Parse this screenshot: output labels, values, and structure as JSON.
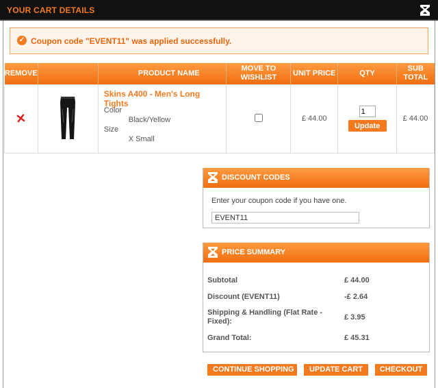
{
  "header": {
    "title": "YOUR CART DETAILS",
    "logo_icon": "brand-logo-icon"
  },
  "notice": {
    "message": "Coupon code \"EVENT11\" was applied successfully.",
    "icon": "check-circle-icon"
  },
  "cart": {
    "columns": [
      "REMOVE",
      "PRODUCT NAME",
      "MOVE TO WISHLIST",
      "UNIT PRICE",
      "QTY",
      "SUB TOTAL"
    ],
    "items": [
      {
        "remove_icon": "remove-x-icon",
        "image": "tights-product-image",
        "name": "Skins A400 - Men's Long Tights",
        "color_label": "Color",
        "color_value": "Black/Yellow",
        "size_label": "Size",
        "size_value": "X Small",
        "wishlist_checked": false,
        "unit_price": "£ 44.00",
        "qty": "1",
        "update_label": "Update",
        "subtotal": "£ 44.00"
      }
    ]
  },
  "discount": {
    "title": "DISCOUNT CODES",
    "prompt": "Enter your coupon code if you have one.",
    "code_value": "EVENT11"
  },
  "summary": {
    "title": "PRICE SUMMARY",
    "rows": [
      {
        "label": "Subtotal",
        "value": "£ 44.00"
      },
      {
        "label": "Discount (EVENT11)",
        "value": "-£ 2.64"
      },
      {
        "label": "Shipping & Handling (Flat Rate - Fixed):",
        "value": "£ 3.95"
      },
      {
        "label": "Grand Total:",
        "value": "£ 45.31"
      }
    ]
  },
  "actions": {
    "continue_label": "CONTINUE SHOPPING",
    "update_cart_label": "UPDATE CART",
    "checkout_label": "CHECKOUT"
  },
  "colors": {
    "accent": "#f47a20",
    "header_bg": "#111111"
  }
}
